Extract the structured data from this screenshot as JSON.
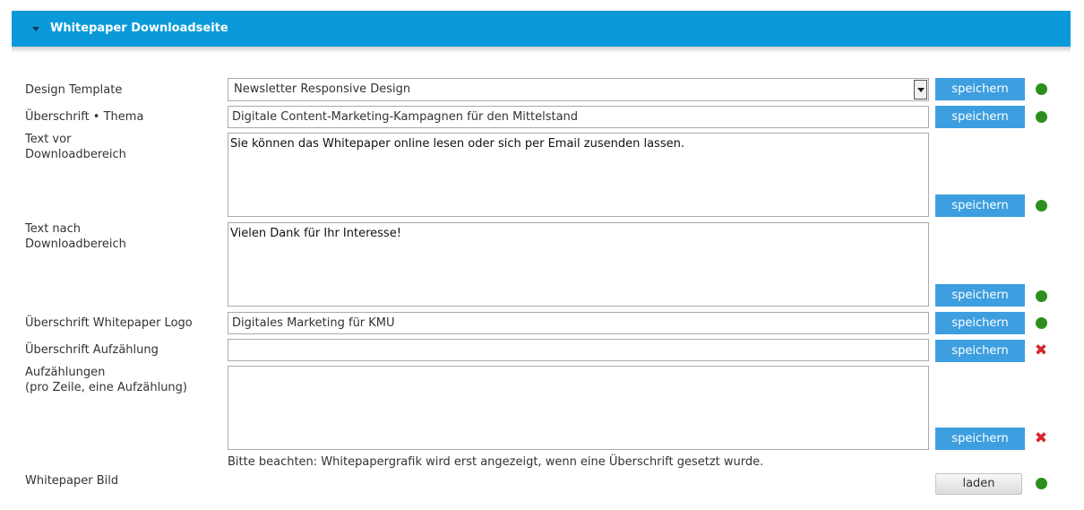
{
  "section": {
    "title": "Whitepaper Downloadseite"
  },
  "fields": {
    "design_template": {
      "label": "Design Template",
      "value": "Newsletter Responsive Design"
    },
    "ueberschrift_thema": {
      "label": "Überschrift • Thema",
      "value": "Digitale Content-Marketing-Kampagnen für den Mittelstand"
    },
    "text_vor": {
      "label_line1": "Text vor",
      "label_line2": "Downloadbereich",
      "value": "Sie können das Whitepaper online lesen oder sich per Email zusenden lassen."
    },
    "text_nach": {
      "label_line1": "Text nach",
      "label_line2": "Downloadbereich",
      "value": "Vielen Dank für Ihr Interesse!"
    },
    "ueberschrift_logo": {
      "label": "Überschrift Whitepaper Logo",
      "value": "Digitales Marketing für KMU"
    },
    "ueberschrift_aufzaehlung": {
      "label": "Überschrift Aufzählung",
      "value": ""
    },
    "aufzaehlungen": {
      "label_line1": "Aufzählungen",
      "label_line2": "(pro Zeile, eine Aufzählung)",
      "value": ""
    },
    "whitepaper_bild": {
      "label": "Whitepaper Bild"
    }
  },
  "note": "Bitte beachten: Whitepapergrafik wird erst angezeigt, wenn eine Überschrift gesetzt wurde.",
  "buttons": {
    "save": "speichern",
    "load": "laden"
  },
  "status_colors": {
    "ok": "#2c8f1d",
    "error": "#d8262b"
  },
  "status_icons": {
    "ok": "green-dot-icon",
    "error": "red-cross-icon",
    "cross_glyph": "✖"
  }
}
